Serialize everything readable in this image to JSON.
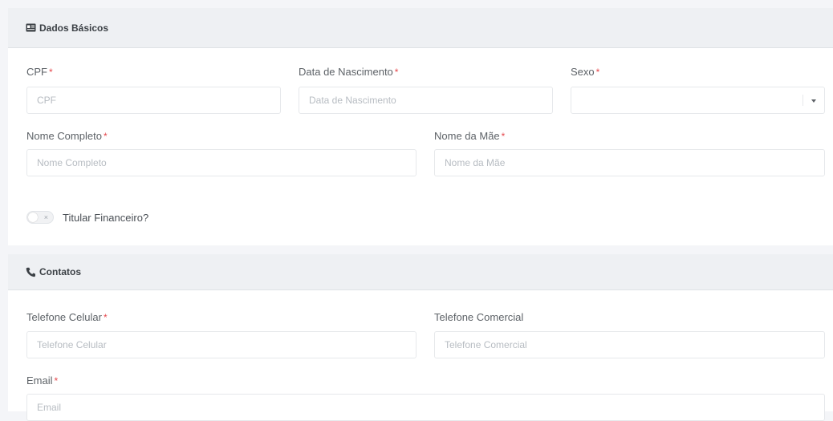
{
  "dados_basicos": {
    "title": "Dados Básicos",
    "icon": "id-card-icon",
    "cpf": {
      "label": "CPF",
      "placeholder": "CPF",
      "required_mark": "*"
    },
    "data_nascimento": {
      "label": "Data de Nascimento",
      "placeholder": "Data de Nascimento",
      "required_mark": "*"
    },
    "sexo": {
      "label": "Sexo",
      "value": "",
      "required_mark": "*"
    },
    "nome_completo": {
      "label": "Nome Completo",
      "placeholder": "Nome Completo",
      "required_mark": "*"
    },
    "nome_mae": {
      "label": "Nome da Mãe",
      "placeholder": "Nome da Mãe",
      "required_mark": "*"
    },
    "titular_financeiro": {
      "label": "Titular Financeiro?",
      "checked": false,
      "off_glyph": "×"
    }
  },
  "contatos": {
    "title": "Contatos",
    "icon": "phone-icon",
    "telefone_celular": {
      "label": "Telefone Celular",
      "placeholder": "Telefone Celular",
      "required_mark": "*"
    },
    "telefone_comercial": {
      "label": "Telefone Comercial",
      "placeholder": "Telefone Comercial"
    },
    "email": {
      "label": "Email",
      "placeholder": "Email",
      "required_mark": "*"
    }
  }
}
